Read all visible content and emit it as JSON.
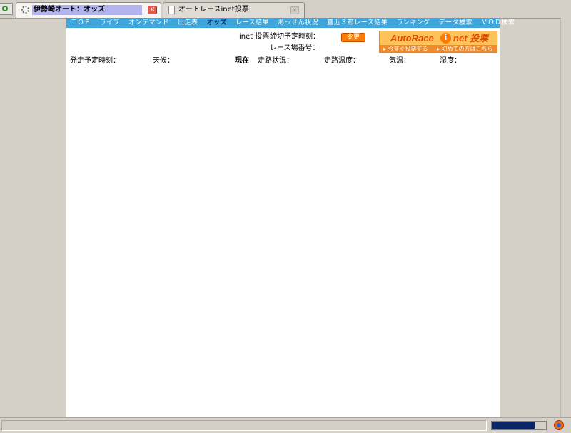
{
  "browser": {
    "tabs": [
      {
        "title": "伊勢崎オート：オッズ",
        "active": true
      },
      {
        "title": "オートレースinet投票",
        "active": false
      }
    ],
    "status_text": "",
    "progress_fraction": 0.8
  },
  "nav": {
    "items": [
      "ＴＯＰ",
      "ライブ",
      "オンデマンド",
      "出走表",
      "オッズ",
      "レース結果",
      "あっせん状況",
      "直近３節レース結果",
      "ランキング",
      "データ検索",
      "ＶＯＤ検索"
    ],
    "current": "オッズ"
  },
  "header": {
    "inet_label": "inet 投票",
    "deadline_label": "締切予定時刻：",
    "change_button": "変更",
    "venue_label": "レース場番号："
  },
  "banner": {
    "brand": "AutoRace",
    "brand_i": "i",
    "brand_suffix": "net 投票",
    "link_vote": "今すぐ投票する",
    "link_first": "初めての方はこちら"
  },
  "race_info": {
    "start_time_label": "発走予定時刻：",
    "weather_label": "天候：",
    "current_label": "現在",
    "track_condition_label": "走路状況：",
    "track_temp_label": "走路温度：",
    "air_temp_label": "気温：",
    "humidity_label": "湿度："
  },
  "colors": {
    "nav_bg": "#3ea6dc",
    "accent_orange": "#ff7a00",
    "active_tab_highlight": "#b3b3ee"
  }
}
